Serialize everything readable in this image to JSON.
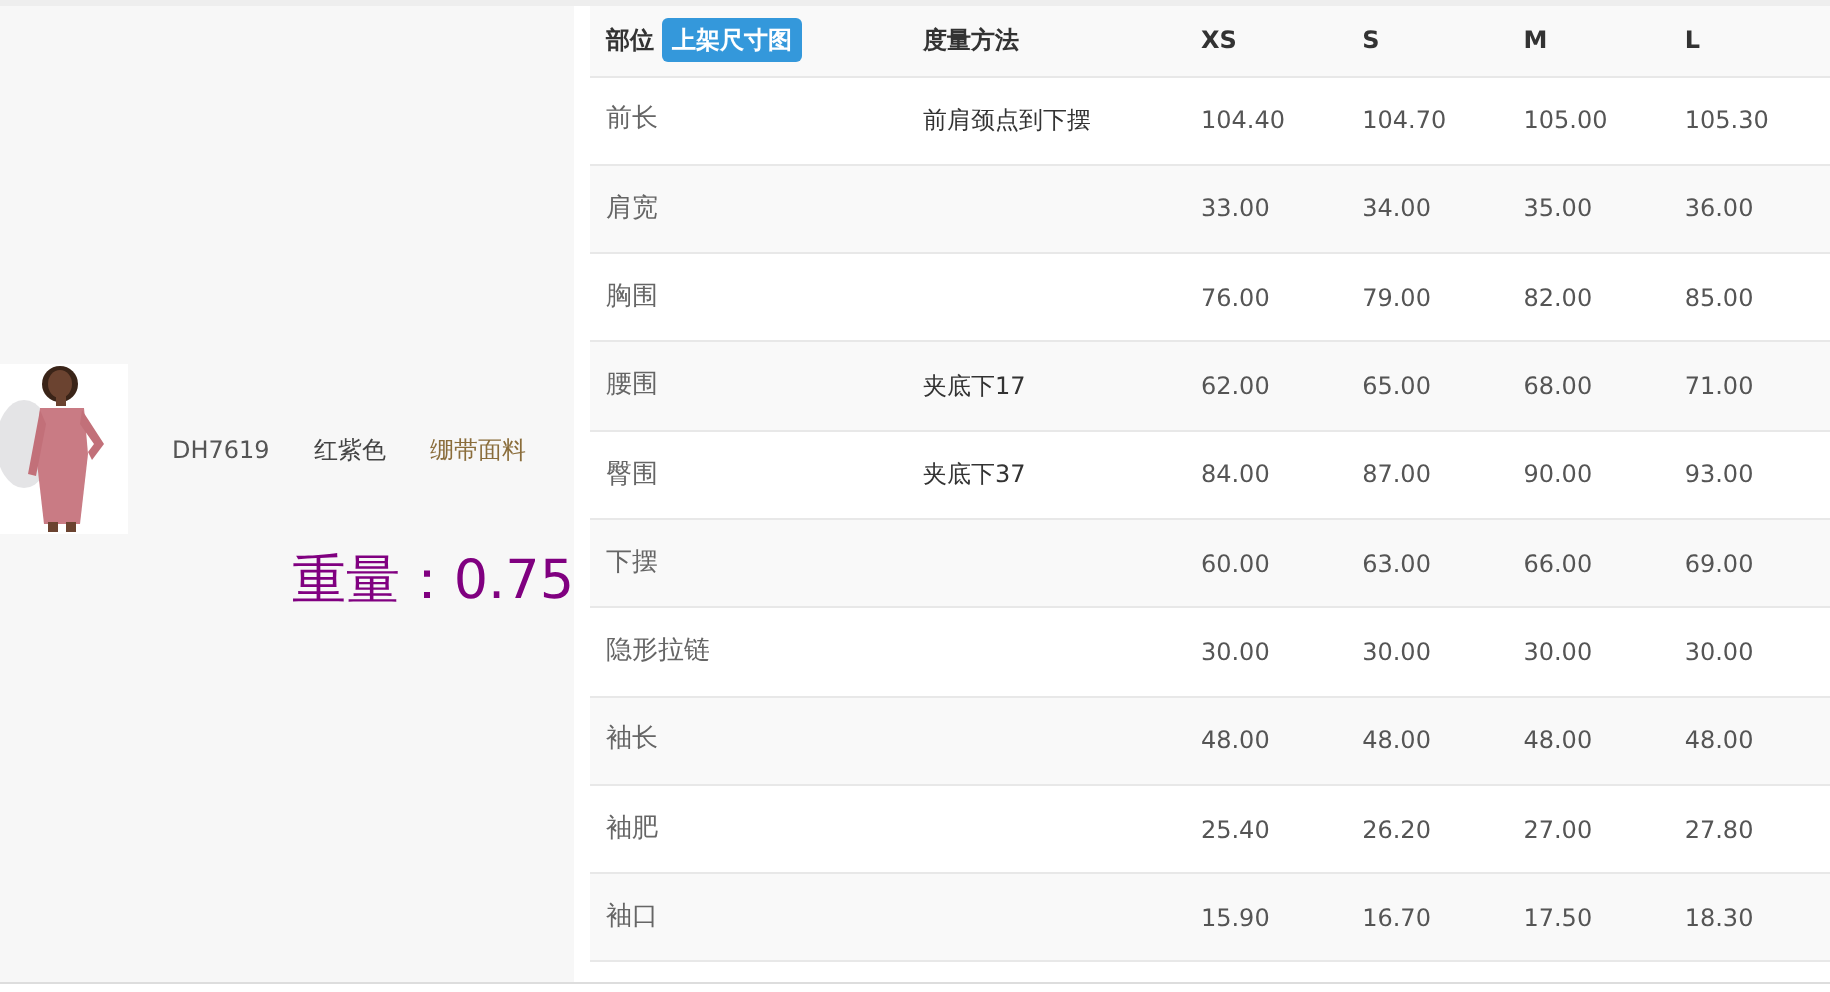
{
  "product": {
    "code": "DH7619",
    "color_name": "红紫色",
    "material": "绷带面料",
    "weight": "重量：0.75"
  },
  "table": {
    "columns": [
      {
        "label": "部位",
        "badge": "上架尺寸图"
      },
      {
        "label": "度量方法"
      },
      {
        "label": "XS"
      },
      {
        "label": "S"
      },
      {
        "label": "M"
      },
      {
        "label": "L"
      }
    ],
    "rows": [
      {
        "part": "前长",
        "method": "前肩颈点到下摆",
        "values": [
          "104.40",
          "104.70",
          "105.00",
          "105.30"
        ]
      },
      {
        "part": "肩宽",
        "values": [
          "33.00",
          "34.00",
          "35.00",
          "36.00"
        ]
      },
      {
        "part": "胸围",
        "values": [
          "76.00",
          "79.00",
          "82.00",
          "85.00"
        ]
      },
      {
        "part": "腰围",
        "method": "夹底下17",
        "values": [
          "62.00",
          "65.00",
          "68.00",
          "71.00"
        ]
      },
      {
        "part": "臀围",
        "method": "夹底下37",
        "values": [
          "84.00",
          "87.00",
          "90.00",
          "93.00"
        ]
      },
      {
        "part": "下摆",
        "values": [
          "60.00",
          "63.00",
          "66.00",
          "69.00"
        ]
      },
      {
        "part": "隐形拉链",
        "values": [
          "30.00",
          "30.00",
          "30.00",
          "30.00"
        ]
      },
      {
        "part": "袖长",
        "values": [
          "48.00",
          "48.00",
          "48.00",
          "48.00"
        ]
      },
      {
        "part": "袖肥",
        "values": [
          "25.40",
          "26.20",
          "27.00",
          "27.80"
        ]
      },
      {
        "part": "袖口",
        "values": [
          "15.90",
          "16.70",
          "17.50",
          "18.30"
        ]
      }
    ]
  }
}
